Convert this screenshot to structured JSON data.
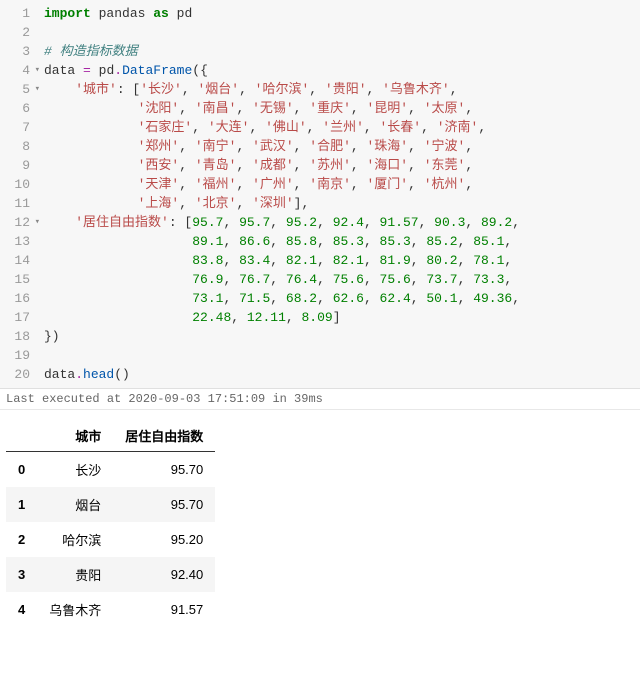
{
  "code": {
    "line1": {
      "import": "import",
      "pandas": "pandas",
      "as": "as",
      "pd": "pd"
    },
    "line3_comment": "# 构造指标数据",
    "line4": {
      "data": "data",
      "eq": "=",
      "pd": "pd",
      "dot": ".",
      "DataFrame": "DataFrame",
      "open": "({"
    },
    "key_city": "'城市'",
    "city_row1": [
      "'长沙'",
      "'烟台'",
      "'哈尔滨'",
      "'贵阳'",
      "'乌鲁木齐'"
    ],
    "city_row2": [
      "'沈阳'",
      "'南昌'",
      "'无锡'",
      "'重庆'",
      "'昆明'",
      "'太原'"
    ],
    "city_row3": [
      "'石家庄'",
      "'大连'",
      "'佛山'",
      "'兰州'",
      "'长春'",
      "'济南'"
    ],
    "city_row4": [
      "'郑州'",
      "'南宁'",
      "'武汉'",
      "'合肥'",
      "'珠海'",
      "'宁波'"
    ],
    "city_row5": [
      "'西安'",
      "'青岛'",
      "'成都'",
      "'苏州'",
      "'海口'",
      "'东莞'"
    ],
    "city_row6": [
      "'天津'",
      "'福州'",
      "'广州'",
      "'南京'",
      "'厦门'",
      "'杭州'"
    ],
    "city_row7": [
      "'上海'",
      "'北京'",
      "'深圳'"
    ],
    "key_index": "'居住自由指数'",
    "num_row1": [
      "95.7",
      "95.7",
      "95.2",
      "92.4",
      "91.57",
      "90.3",
      "89.2"
    ],
    "num_row2": [
      "89.1",
      "86.6",
      "85.8",
      "85.3",
      "85.3",
      "85.2",
      "85.1"
    ],
    "num_row3": [
      "83.8",
      "83.4",
      "82.1",
      "82.1",
      "81.9",
      "80.2",
      "78.1"
    ],
    "num_row4": [
      "76.9",
      "76.7",
      "76.4",
      "75.6",
      "75.6",
      "73.7",
      "73.3"
    ],
    "num_row5": [
      "73.1",
      "71.5",
      "68.2",
      "62.6",
      "62.4",
      "50.1",
      "49.36"
    ],
    "num_row6": [
      "22.48",
      "12.11",
      "8.09"
    ],
    "close": "})",
    "line20": {
      "data": "data",
      "dot": ".",
      "head": "head",
      "paren": "()"
    }
  },
  "status": "Last executed at 2020-09-03 17:51:09 in 39ms",
  "table": {
    "columns": [
      "城市",
      "居住自由指数"
    ],
    "index": [
      "0",
      "1",
      "2",
      "3",
      "4"
    ],
    "rows": [
      [
        "长沙",
        "95.70"
      ],
      [
        "烟台",
        "95.70"
      ],
      [
        "哈尔滨",
        "95.20"
      ],
      [
        "贵阳",
        "92.40"
      ],
      [
        "乌鲁木齐",
        "91.57"
      ]
    ]
  },
  "chart_data": {
    "type": "table",
    "title": "data.head()",
    "columns": [
      "城市",
      "居住自由指数"
    ],
    "rows": [
      [
        "长沙",
        95.7
      ],
      [
        "烟台",
        95.7
      ],
      [
        "哈尔滨",
        95.2
      ],
      [
        "贵阳",
        92.4
      ],
      [
        "乌鲁木齐",
        91.57
      ]
    ]
  }
}
